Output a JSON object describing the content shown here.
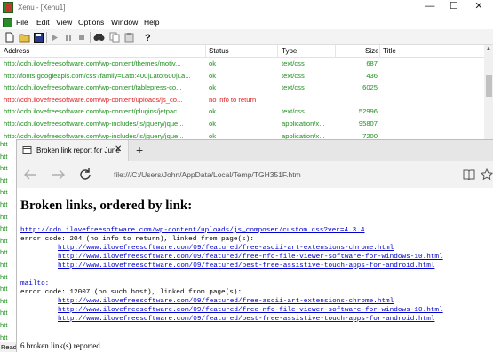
{
  "xenu": {
    "title": "Xenu - [Xenu1]",
    "window_controls": {
      "minimize": "—",
      "maximize": "☐",
      "close": "✕"
    },
    "menu": [
      "File",
      "Edit",
      "View",
      "Options",
      "Window",
      "Help"
    ],
    "toolbar_icons": [
      "new-file-icon",
      "open-folder-icon",
      "save-icon",
      "play-icon",
      "pause-icon",
      "stop-icon",
      "find-icon",
      "copy-icon",
      "paste-icon",
      "help-icon"
    ],
    "columns": {
      "address": "Address",
      "status": "Status",
      "type": "Type",
      "size": "Size",
      "title": "Title"
    },
    "rows": [
      {
        "address": "http://cdn.ilovefreesoftware.com/wp-content/themes/motiv...",
        "status": "ok",
        "type": "text/css",
        "size": "687",
        "error": false
      },
      {
        "address": "http://fonts.googleapis.com/css?family=Lato:400|Lato:600|La...",
        "status": "ok",
        "type": "text/css",
        "size": "436",
        "error": false
      },
      {
        "address": "http://cdn.ilovefreesoftware.com/wp-content/tablepress-co...",
        "status": "ok",
        "type": "text/css",
        "size": "6025",
        "error": false
      },
      {
        "address": "http://cdn.ilovefreesoftware.com/wp-content/uploads/js_co...",
        "status": "no info to return",
        "type": "",
        "size": "",
        "error": true
      },
      {
        "address": "http://cdn.ilovefreesoftware.com/wp-content/plugins/jetpac...",
        "status": "ok",
        "type": "text/css",
        "size": "52996",
        "error": false
      },
      {
        "address": "http://cdn.ilovefreesoftware.com/wp-includes/js/jquery/jque...",
        "status": "ok",
        "type": "application/x...",
        "size": "95807",
        "error": false
      },
      {
        "address": "http://cdn.ilovefreesoftware.com/wp-includes/js/jquery/jque...",
        "status": "ok",
        "type": "application/x...",
        "size": "7200",
        "error": false
      }
    ],
    "left_partial_rows": [
      "htt",
      "htt",
      "htt",
      "htt",
      "htt",
      "htt",
      "htt",
      "htt",
      "htt",
      "htt",
      "htt",
      "htt",
      "htt",
      "htt",
      "htt",
      "htt",
      "htt"
    ],
    "status_bar": "Read"
  },
  "browser": {
    "tab_title": "Broken link report for June",
    "new_tab": "+",
    "tab_close": "✕",
    "address": "file:///C:/Users/John/AppData/Local/Temp/TGH351F.htm",
    "report": {
      "heading": "Broken links, ordered by link:",
      "entries": [
        {
          "link": "http://cdn.ilovefreesoftware.com/wp-content/uploads/js_composer/custom.css?ver=4.3.4",
          "error_line": "error code: 204 (no info to return), linked from page(s):",
          "pages": [
            "http://www.ilovefreesoftware.com/09/featured/free-ascii-art-extensions-chrome.html",
            "http://www.ilovefreesoftware.com/09/featured/free-nfo-file-viewer-software-for-windows-10.html",
            "http://www.ilovefreesoftware.com/09/featured/best-free-assistive-touch-apps-for-android.html"
          ]
        },
        {
          "link": "mailto:",
          "error_line": "error code: 12007 (no such host), linked from page(s):",
          "pages": [
            "http://www.ilovefreesoftware.com/09/featured/free-ascii-art-extensions-chrome.html",
            "http://www.ilovefreesoftware.com/09/featured/free-nfo-file-viewer-software-for-windows-10.html",
            "http://www.ilovefreesoftware.com/09/featured/best-free-assistive-touch-apps-for-android.html"
          ]
        }
      ],
      "footer": "6 broken link(s) reported"
    }
  },
  "colors": {
    "ok": "#1f8f1f",
    "error": "#e01e1e",
    "link": "#0000cc"
  }
}
